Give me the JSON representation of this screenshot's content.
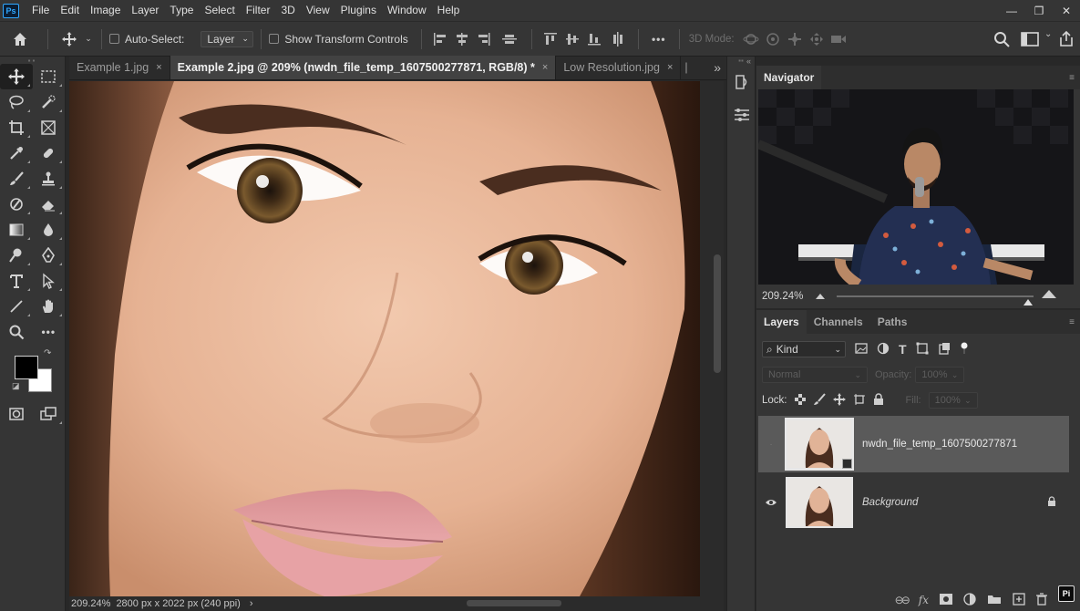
{
  "app": {
    "logo_text": "Ps"
  },
  "menu": [
    "File",
    "Edit",
    "Image",
    "Layer",
    "Type",
    "Select",
    "Filter",
    "3D",
    "View",
    "Plugins",
    "Window",
    "Help"
  ],
  "window_controls": {
    "minimize": "—",
    "restore": "❐",
    "close": "✕"
  },
  "options": {
    "auto_select_label": "Auto-Select:",
    "auto_select_value": "Layer",
    "show_transform_label": "Show Transform Controls",
    "more_label": "•••",
    "mode_3d_label": "3D Mode:"
  },
  "tabs": [
    {
      "label": "Example 1.jpg",
      "close": "×"
    },
    {
      "label": "Example 2.jpg @ 209% (nwdn_file_temp_1607500277871, RGB/8) *",
      "close": "×"
    },
    {
      "label": "Low Resolution.jpg",
      "close": "×"
    }
  ],
  "tabs_overflow": "»",
  "status": {
    "zoom": "209.24%",
    "doc_info": "2800 px x 2022 px (240 ppi)",
    "arrow": "›"
  },
  "navigator": {
    "title": "Navigator",
    "zoom": "209.24%"
  },
  "layers_panel": {
    "tabs": [
      "Layers",
      "Channels",
      "Paths"
    ],
    "filter_kind": "Kind",
    "blend_mode": "Normal",
    "opacity_label": "Opacity:",
    "opacity_value": "100%",
    "lock_label": "Lock:",
    "fill_label": "Fill:",
    "fill_value": "100%",
    "layers": [
      {
        "name": "nwdn_file_temp_1607500277871",
        "selected": true
      },
      {
        "name": "Background",
        "selected": false
      }
    ],
    "footer": {
      "link": "⊖⊖",
      "fx": "fx"
    }
  },
  "badge": "Pi",
  "colors": {
    "foreground": "#000000",
    "background": "#ffffff",
    "accent": "#31a8ff"
  }
}
